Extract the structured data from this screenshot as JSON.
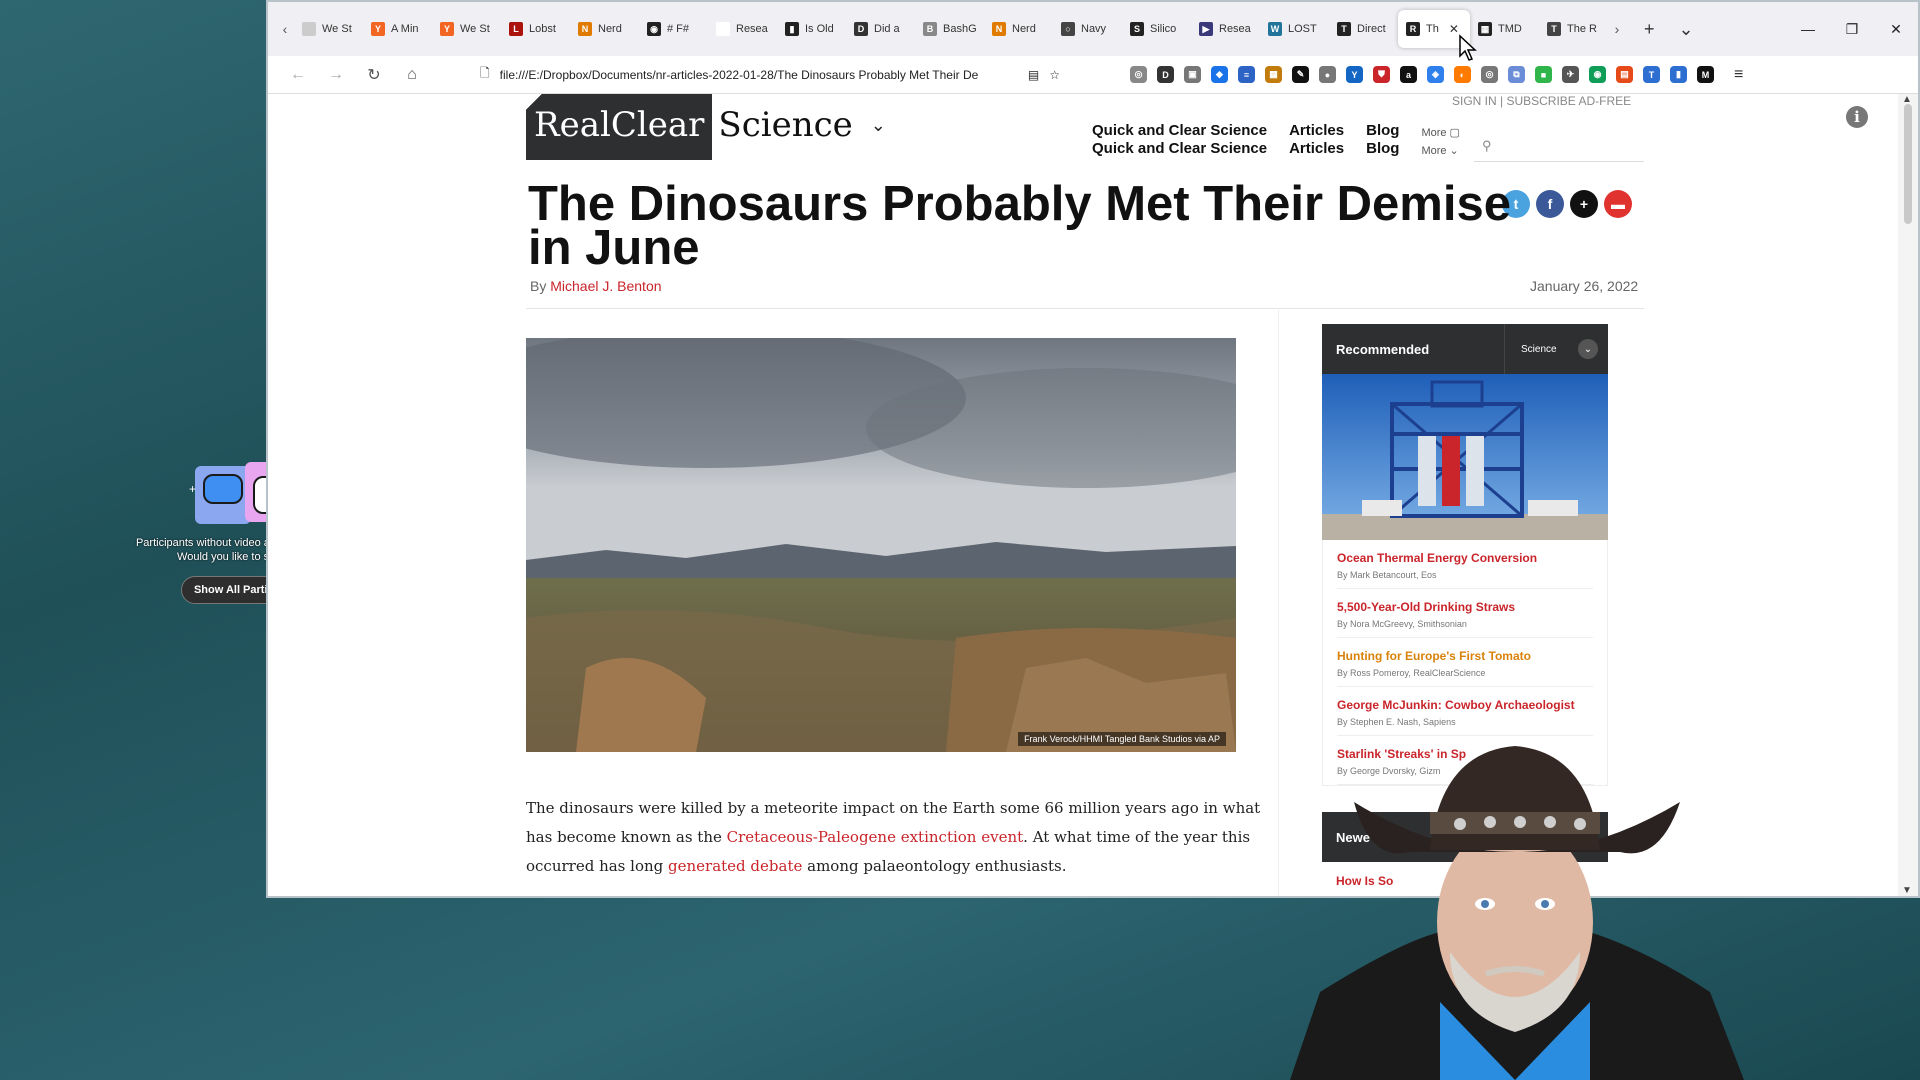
{
  "zoom": {
    "message_line1": "Participants without video are currently hidden.",
    "message_line2": "Would you like to show them?",
    "button": "Show All Participants"
  },
  "browser": {
    "tabs": [
      {
        "label": "We St",
        "color": "#cccccc",
        "glyph": ""
      },
      {
        "label": "A Min",
        "color": "#f26522",
        "glyph": "Y"
      },
      {
        "label": "We St",
        "color": "#f26522",
        "glyph": "Y"
      },
      {
        "label": "Lobst",
        "color": "#ac130d",
        "glyph": "L"
      },
      {
        "label": "Nerd",
        "color": "#e07b00",
        "glyph": "N"
      },
      {
        "label": "# F#",
        "color": "#222222",
        "glyph": "◉"
      },
      {
        "label": "Resea",
        "color": "#ffffff",
        "glyph": ""
      },
      {
        "label": "Is Old",
        "color": "#222222",
        "glyph": "▮"
      },
      {
        "label": "Did a",
        "color": "#333333",
        "glyph": "D"
      },
      {
        "label": "BashG",
        "color": "#888888",
        "glyph": "B"
      },
      {
        "label": "Nerd",
        "color": "#e07b00",
        "glyph": "N"
      },
      {
        "label": "Navy",
        "color": "#444444",
        "glyph": "○"
      },
      {
        "label": "Silico",
        "color": "#222222",
        "glyph": "S"
      },
      {
        "label": "Resea",
        "color": "#3a3a7a",
        "glyph": "▶"
      },
      {
        "label": "LOST",
        "color": "#21759b",
        "glyph": "W"
      },
      {
        "label": "Direct",
        "color": "#222222",
        "glyph": "T"
      }
    ],
    "active_tab": {
      "label": "Th",
      "glyph": "R"
    },
    "tabs_after": [
      {
        "label": "TMD",
        "color": "#222222",
        "glyph": "▦"
      },
      {
        "label": "The R",
        "color": "#444444",
        "glyph": "T"
      }
    ],
    "url": "file:///E:/Dropbox/Documents/nr-articles-2022-01-28/The Dinosaurs Probably Met Their De",
    "extensions": [
      {
        "color": "#888888",
        "glyph": "◎"
      },
      {
        "color": "#333333",
        "glyph": "D"
      },
      {
        "color": "#777777",
        "glyph": "▣"
      },
      {
        "color": "#1a73e8",
        "glyph": "◆"
      },
      {
        "color": "#2e63c6",
        "glyph": "≡"
      },
      {
        "color": "#c27c0e",
        "glyph": "▦"
      },
      {
        "color": "#111111",
        "glyph": "✎"
      },
      {
        "color": "#777777",
        "glyph": "●"
      },
      {
        "color": "#1466c4",
        "glyph": "Y"
      },
      {
        "color": "#c9252b",
        "glyph": "⛊"
      },
      {
        "color": "#111111",
        "glyph": "a"
      },
      {
        "color": "#2f80ed",
        "glyph": "◈"
      },
      {
        "color": "#ff7a00",
        "glyph": "◐"
      },
      {
        "color": "#777777",
        "glyph": "◎"
      },
      {
        "color": "#6b8cd6",
        "glyph": "⧉"
      },
      {
        "color": "#2fb54a",
        "glyph": "■"
      },
      {
        "color": "#555555",
        "glyph": "✈"
      },
      {
        "color": "#0f9d58",
        "glyph": "◉"
      },
      {
        "color": "#e64a19",
        "glyph": "▤"
      },
      {
        "color": "#2d6fd0",
        "glyph": "T"
      },
      {
        "color": "#2d6fd0",
        "glyph": "▮"
      },
      {
        "color": "#111111",
        "glyph": "M"
      }
    ]
  },
  "site": {
    "top_links": "SIGN IN  |  SUBSCRIBE AD-FREE",
    "logo_dark": "RealClear",
    "logo_light": "Science",
    "nav": [
      {
        "a": "Quick and Clear Science",
        "b": "Quick and Clear Science"
      },
      {
        "a": "Articles",
        "b": "Articles"
      },
      {
        "a": "Blog",
        "b": "Blog"
      }
    ],
    "more_a": "More ▢",
    "more_b": "More ⌄",
    "social": [
      {
        "color": "#4aa3df",
        "glyph": "t"
      },
      {
        "color": "#3b5998",
        "glyph": "f"
      },
      {
        "color": "#111111",
        "glyph": "+"
      },
      {
        "color": "#e0332f",
        "glyph": "▬"
      }
    ]
  },
  "article": {
    "title": "The Dinosaurs Probably Met Their Demise in June",
    "by": "By ",
    "author": "Michael J. Benton",
    "date": "January 26, 2022",
    "photo_credit": "Frank Verock/HHMI Tangled Bank Studios via AP",
    "p1_a": "The dinosaurs were killed by a meteorite impact on the Earth some 66 million years ago in what has become known as the ",
    "p1_link1": "Cretaceous-Paleogene extinction event",
    "p1_b": ". At what time of the year this occurred has long ",
    "p1_link2": "generated debate",
    "p1_c": " among palaeontology enthusiasts."
  },
  "recommended": {
    "title": "Recommended",
    "category": "Science",
    "items": [
      {
        "title": "Ocean Thermal Energy Conversion",
        "by": "By Mark Betancourt, Eos",
        "style": "red"
      },
      {
        "title": "5,500-Year-Old Drinking Straws",
        "by": "By Nora McGreevy, Smithsonian",
        "style": "red"
      },
      {
        "title": "Hunting for Europe's First Tomato",
        "by": "By Ross Pomeroy, RealClearScience",
        "style": "orange"
      },
      {
        "title": "George McJunkin: Cowboy Archaeologist",
        "by": "By Stephen E. Nash, Sapiens",
        "style": "red"
      },
      {
        "title": "Starlink 'Streaks' in Sp",
        "by": "By George Dvorsky, Gizm",
        "style": "red"
      }
    ],
    "newest_title": "Newe",
    "newest_item": "How Is So"
  }
}
